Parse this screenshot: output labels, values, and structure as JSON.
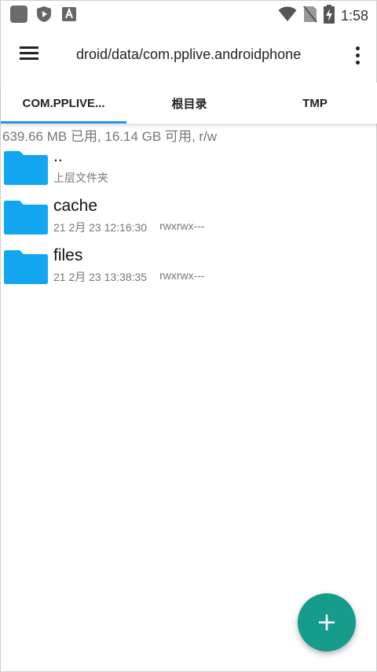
{
  "status_bar": {
    "time": "1:58",
    "icons": [
      "app-square-icon",
      "shield-play-icon",
      "text-app-icon",
      "wifi-icon",
      "no-sim-icon",
      "battery-charging-icon"
    ]
  },
  "toolbar": {
    "path": "droid/data/com.pplive.androidphone"
  },
  "tabs": [
    {
      "label": "COM.PPLIVE...",
      "active": true
    },
    {
      "label": "根目录",
      "active": false
    },
    {
      "label": "TMP",
      "active": false
    }
  ],
  "storage": {
    "text": "639.66 MB 已用, 16.14 GB 可用, r/w"
  },
  "files": [
    {
      "name": "..",
      "date": "上层文件夹",
      "perms": ""
    },
    {
      "name": "cache",
      "date": "21 2月 23 12:16:30",
      "perms": "rwxrwx---"
    },
    {
      "name": "files",
      "date": "21 2月 23 13:38:35",
      "perms": "rwxrwx---"
    }
  ],
  "colors": {
    "folder": "#12a5f0",
    "tab_indicator": "#2196f3",
    "fab": "#169c8a"
  },
  "fab": {
    "icon": "plus-icon"
  }
}
